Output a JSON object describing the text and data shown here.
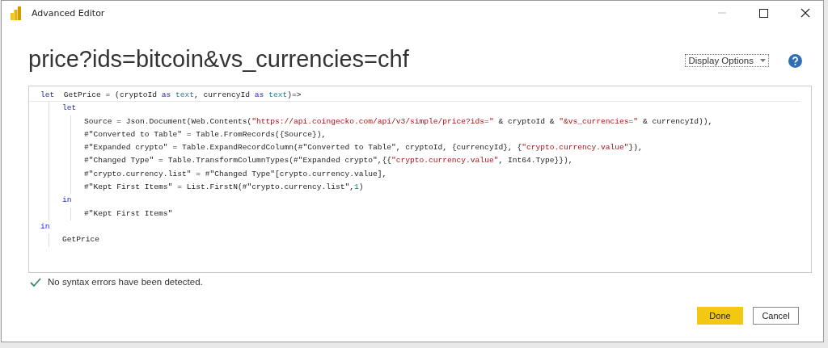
{
  "window": {
    "title": "Advanced Editor"
  },
  "query_name": "price?ids=bitcoin&vs_currencies=chf",
  "display_options": {
    "label": "Display Options"
  },
  "code": [
    {
      "tokens": [
        {
          "kind": "keyword",
          "text": "let"
        },
        {
          "kind": "plain",
          "text": "  GetPrice = (cryptoId "
        },
        {
          "kind": "keyword",
          "text": "as"
        },
        {
          "kind": "type",
          "text": " text"
        },
        {
          "kind": "plain",
          "text": ", currencyId "
        },
        {
          "kind": "keyword",
          "text": "as"
        },
        {
          "kind": "type",
          "text": " text"
        },
        {
          "kind": "plain",
          "text": ")=>"
        }
      ],
      "children": [
        {
          "tokens": [
            {
              "kind": "keyword",
              "text": "let"
            }
          ],
          "children": [
            {
              "tokens": [
                {
                  "kind": "plain",
                  "text": "Source = Json.Document(Web.Contents("
                },
                {
                  "kind": "string",
                  "text": "\"https://api.coingecko.com/api/v3/simple/price?ids=\""
                },
                {
                  "kind": "plain",
                  "text": " & cryptoId & "
                },
                {
                  "kind": "string",
                  "text": "\"&vs_currencies=\""
                },
                {
                  "kind": "plain",
                  "text": " & currencyId)),"
                }
              ]
            },
            {
              "tokens": [
                {
                  "kind": "plain",
                  "text": "#\"Converted to Table\" = Table.FromRecords({Source}),"
                }
              ]
            },
            {
              "tokens": [
                {
                  "kind": "plain",
                  "text": "#\"Expanded crypto\" = Table.ExpandRecordColumn(#\"Converted to Table\", cryptoId, {currencyId}, {"
                },
                {
                  "kind": "string",
                  "text": "\"crypto.currency.value\""
                },
                {
                  "kind": "plain",
                  "text": "}),"
                }
              ]
            },
            {
              "tokens": [
                {
                  "kind": "plain",
                  "text": "#\"Changed Type\" = Table.TransformColumnTypes(#\"Expanded crypto\",{{"
                },
                {
                  "kind": "string",
                  "text": "\"crypto.currency.value\""
                },
                {
                  "kind": "plain",
                  "text": ", Int64.Type}}),"
                }
              ]
            },
            {
              "tokens": [
                {
                  "kind": "plain",
                  "text": "#\"crypto.currency.list\" = #\"Changed Type\"[crypto.currency.value],"
                }
              ]
            },
            {
              "tokens": [
                {
                  "kind": "plain",
                  "text": "#\"Kept First Items\" = List.FirstN(#\"crypto.currency.list\","
                },
                {
                  "kind": "number",
                  "text": "1"
                },
                {
                  "kind": "plain",
                  "text": ")"
                }
              ]
            }
          ]
        },
        {
          "tokens": [
            {
              "kind": "keyword",
              "text": "in"
            }
          ],
          "children": [
            {
              "tokens": [
                {
                  "kind": "plain",
                  "text": "#\"Kept First Items\""
                }
              ]
            }
          ]
        }
      ]
    },
    {
      "tokens": [
        {
          "kind": "keyword",
          "text": "in"
        }
      ],
      "children": [
        {
          "tokens": [
            {
              "kind": "plain",
              "text": "GetPrice"
            }
          ]
        }
      ]
    }
  ],
  "status": {
    "valid": true,
    "message": "No syntax errors have been detected."
  },
  "buttons": [
    {
      "label": "Done",
      "primary": true
    },
    {
      "label": "Cancel",
      "primary": false
    }
  ]
}
